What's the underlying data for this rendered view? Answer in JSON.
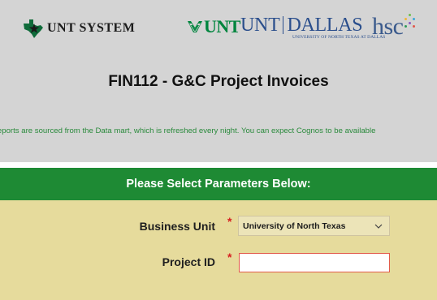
{
  "logos": {
    "unt_system": "UNT SYSTEM",
    "unt": "UNT",
    "unt_dallas": {
      "unt": "UNT",
      "dallas": "DALLAS",
      "subtitle": "UNIVERSITY OF NORTH TEXAS AT DALLAS"
    },
    "hsc": "hsc"
  },
  "page": {
    "title": "FIN112 - G&C Project Invoices",
    "notice": "Reports are sourced from the Data mart, which is refreshed every night. You can expect Cognos to be available"
  },
  "parameters": {
    "heading": "Please Select Parameters Below:",
    "business_unit": {
      "label": "Business Unit",
      "required_mark": "*",
      "selected": "University of North Texas",
      "icon": "chevron-down-icon"
    },
    "project_id": {
      "label": "Project ID",
      "required_mark": "*",
      "value": ""
    }
  },
  "colors": {
    "header_bg": "#d4d4d4",
    "band_green": "#1e8a34",
    "form_bg": "#e6db9c",
    "notice_green": "#2a8a3c",
    "required_red": "#d62020",
    "unt_green": "#00853e",
    "dallas_blue": "#2a4e8c"
  }
}
